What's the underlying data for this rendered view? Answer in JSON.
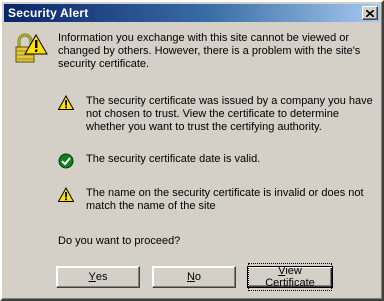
{
  "window": {
    "title": "Security Alert",
    "colors": {
      "title_start": "#0a246a",
      "title_end": "#a6caf0",
      "face": "#d4d0c8"
    }
  },
  "intro": "Information you exchange with this site cannot be viewed or changed by others. However, there is a problem with the site's security certificate.",
  "items": [
    {
      "icon": "warning-icon",
      "text": "The security certificate was issued by a company you have not chosen to trust. View the certificate to determine whether you want to trust the certifying authority."
    },
    {
      "icon": "check-icon",
      "text": "The security certificate date is valid."
    },
    {
      "icon": "warning-icon",
      "text": "The name on the security certificate is invalid or does not match the name of the site"
    }
  ],
  "question": "Do you want to proceed?",
  "buttons": {
    "yes": {
      "mnemonic": "Y",
      "rest": "es"
    },
    "no": {
      "mnemonic": "N",
      "rest": "o"
    },
    "view": {
      "mnemonic": "V",
      "rest": "iew Certificate"
    }
  }
}
